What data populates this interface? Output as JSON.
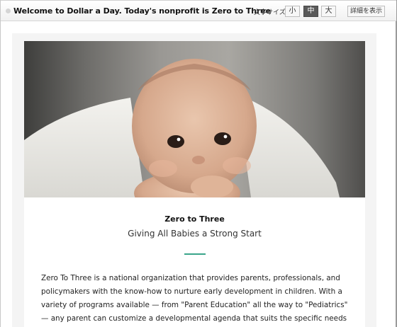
{
  "header": {
    "title": "Welcome to Dollar a Day. Today's nonprofit is Zero to Three",
    "font_size_label": "文字サイズ:",
    "size_options": [
      "小",
      "中",
      "大"
    ],
    "active_size": "中",
    "detail_button": "詳細を表示"
  },
  "article": {
    "hero_image": "baby-under-blanket",
    "org_name": "Zero to Three",
    "tagline": "Giving All Babies a Strong Start",
    "accent_color": "#3aa58a",
    "description": "Zero To Three is a national organization that provides parents, professionals, and policymakers with the know-how to nurture early development in children. With a variety of programs available — from \"Parent Education\" all the way to \"Pediatrics\" — any parent can customize a developmental agenda that suits the specific needs of"
  }
}
